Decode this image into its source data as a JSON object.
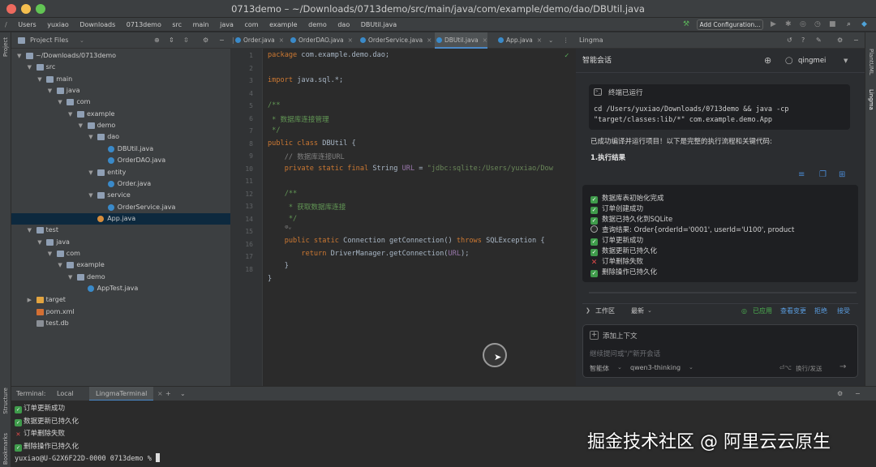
{
  "window": {
    "title": "0713demo – ~/Downloads/0713demo/src/main/java/com/example/demo/dao/DBUtil.java"
  },
  "navbar": {
    "breadcrumbs": [
      "Users",
      "yuxiao",
      "Downloads",
      "0713demo",
      "src",
      "main",
      "java",
      "com",
      "example",
      "demo",
      "dao",
      "DBUtil.java"
    ],
    "add_config_label": "Add Configuration..."
  },
  "left_stripe": {
    "project_label": "Project",
    "structure_label": "Structure",
    "bookmarks_label": "Bookmarks"
  },
  "right_stripe": {
    "plantuml_label": "PlantUML",
    "lingma_label": "Lingma"
  },
  "project": {
    "header_label": "Project Files",
    "tree": [
      {
        "label": "~/Downloads/0713demo",
        "kind": "folder",
        "expanded": true
      },
      {
        "label": "src",
        "kind": "folder",
        "expanded": true
      },
      {
        "label": "main",
        "kind": "folder",
        "expanded": true
      },
      {
        "label": "java",
        "kind": "folder",
        "expanded": true
      },
      {
        "label": "com",
        "kind": "folder",
        "expanded": true
      },
      {
        "label": "example",
        "kind": "folder",
        "expanded": true
      },
      {
        "label": "demo",
        "kind": "folder",
        "expanded": true
      },
      {
        "label": "dao",
        "kind": "folder",
        "expanded": true
      },
      {
        "label": "DBUtil.java",
        "kind": "java"
      },
      {
        "label": "OrderDAO.java",
        "kind": "java"
      },
      {
        "label": "entity",
        "kind": "folder",
        "expanded": true
      },
      {
        "label": "Order.java",
        "kind": "java"
      },
      {
        "label": "service",
        "kind": "folder",
        "expanded": true
      },
      {
        "label": "OrderService.java",
        "kind": "java"
      },
      {
        "label": "App.java",
        "kind": "java",
        "selected": true
      },
      {
        "label": "test",
        "kind": "folder",
        "expanded": true
      },
      {
        "label": "java",
        "kind": "folder",
        "expanded": true
      },
      {
        "label": "com",
        "kind": "folder",
        "expanded": true
      },
      {
        "label": "example",
        "kind": "folder",
        "expanded": true
      },
      {
        "label": "demo",
        "kind": "folder",
        "expanded": true
      },
      {
        "label": "AppTest.java",
        "kind": "java"
      },
      {
        "label": "target",
        "kind": "folder-orange",
        "expanded": false
      },
      {
        "label": "pom.xml",
        "kind": "xml"
      },
      {
        "label": "test.db",
        "kind": "db"
      }
    ]
  },
  "editor": {
    "tabs": [
      {
        "label": "Order.java"
      },
      {
        "label": "OrderDAO.java"
      },
      {
        "label": "OrderService.java"
      },
      {
        "label": "DBUtil.java",
        "active": true
      },
      {
        "label": "App.java"
      }
    ],
    "line_numbers": [
      "1",
      "2",
      "3",
      "4",
      "5",
      "6",
      "7",
      "8",
      "9",
      "10",
      "11",
      "12",
      "13",
      "14",
      "15",
      "16",
      "17",
      "18"
    ],
    "lines": {
      "l1_kw": "package",
      "l1_rest": " com.example.demo.dao;",
      "l3_kw": "import",
      "l3_rest": " java.sql.*;",
      "l5": "/**",
      "l6": " * 数据库连接管理",
      "l7": " */",
      "l8_kw": "public class",
      "l8_rest": " DBUtil {",
      "l9": "    // 数据库连接URL",
      "l10_kw": "    private static final",
      "l10_type": " String ",
      "l10_field": "URL",
      "l10_eq": " = ",
      "l10_str": "\"jdbc:sqlite:/Users/yuxiao/Dow",
      "l12": "    /**",
      "l13": "     * 获取数据库连接",
      "l14": "     */",
      "l14_hint": "     ⊙⌄",
      "l15_kw": "    public static",
      "l15_rest": " Connection getConnection() ",
      "l15_kw2": "throws",
      "l15_rest2": " SQLException {",
      "l16_kw": "        return",
      "l16_rest": " DriverManager.getConnection(",
      "l16_field": "URL",
      "l16_end": ");",
      "l17": "    }",
      "l18": "}"
    }
  },
  "lingma": {
    "header_label": "Lingma",
    "chat_title": "智能会话",
    "user_name": "qingmei",
    "terminal_run_label": "终端已运行",
    "command_line1": "cd /Users/yuxiao/Downloads/0713demo && java -cp",
    "command_line2": "\"target/classes:lib/*\" com.example.demo.App",
    "summary": "已成功编译并运行项目！以下是完整的执行流程和关键代码:",
    "section_heading": "1.执行结果",
    "results": [
      {
        "icon": "check",
        "text": "数据库表初始化完成"
      },
      {
        "icon": "check",
        "text": "订单创建成功"
      },
      {
        "icon": "check",
        "text": "数据已持久化到SQLite"
      },
      {
        "icon": "search",
        "text": "查询结果: Order{orderId='0001', userId='U100', product"
      },
      {
        "icon": "check",
        "text": "订单更新成功"
      },
      {
        "icon": "check",
        "text": "数据更新已持久化"
      },
      {
        "icon": "cross",
        "text": "订单删除失败"
      },
      {
        "icon": "check",
        "text": "删除操作已持久化"
      }
    ],
    "workspace_label": "工作区",
    "latest_label": "最新",
    "applied_label": "已应用",
    "view_changes_label": "查看变更",
    "reject_label": "拒绝",
    "accept_label": "接受",
    "add_context_label": "添加上下文",
    "input_placeholder": "继续提问或\"/\"新开会话",
    "mode_label": "智能体",
    "model_label": "qwen3-thinking",
    "send_hint": "换行/发送"
  },
  "terminal": {
    "title": "Terminal:",
    "tabs": [
      {
        "label": "Local"
      },
      {
        "label": "LingmaTerminal",
        "active": true
      }
    ],
    "lines": [
      {
        "icon": "check",
        "text": "订单更新成功"
      },
      {
        "icon": "check",
        "text": "数据更新已持久化"
      },
      {
        "icon": "cross",
        "text": "订单删除失败"
      },
      {
        "icon": "check",
        "text": "删除操作已持久化"
      }
    ],
    "prompt": "yuxiao@U-G2X6F22D-0000 0713demo % "
  },
  "watermark": "掘金技术社区 @ 阿里云云原生"
}
